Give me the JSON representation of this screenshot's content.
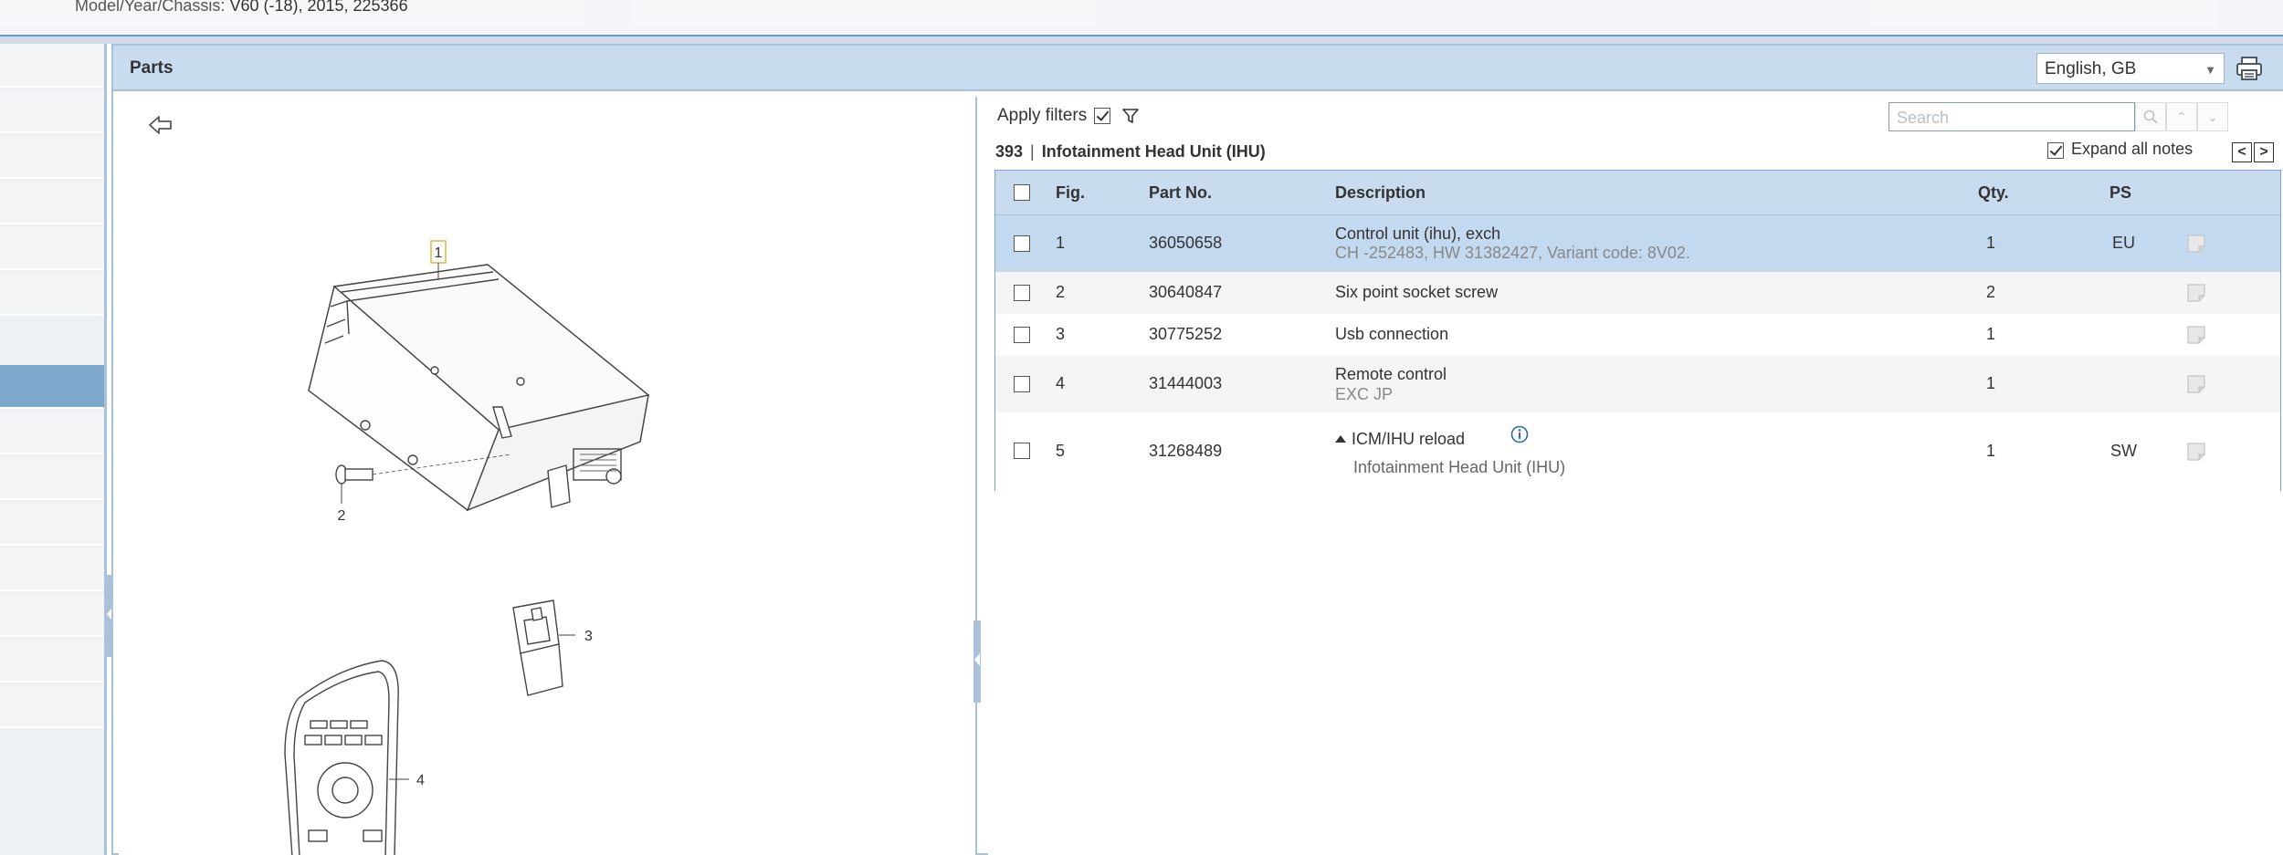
{
  "vehicle": {
    "label": "Model/Year/Chassis:",
    "value": "V60 (-18), 2015, 225366"
  },
  "panel": {
    "title": "Parts",
    "language": "English, GB"
  },
  "illustration": {
    "callouts": [
      "1",
      "2",
      "3",
      "4"
    ]
  },
  "list": {
    "apply_filters_label": "Apply filters",
    "apply_filters_checked": true,
    "search_placeholder": "Search",
    "breadcrumb_code": "393",
    "breadcrumb_sep": "|",
    "breadcrumb_title": "Infotainment Head Unit (IHU)",
    "expand_notes_label": "Expand all notes",
    "expand_notes_checked": true,
    "prev_label": "<",
    "next_label": ">"
  },
  "table": {
    "headers": {
      "fig": "Fig.",
      "part_no": "Part No.",
      "description": "Description",
      "qty": "Qty.",
      "ps": "PS"
    },
    "rows": [
      {
        "fig": "1",
        "part_no": "36050658",
        "description": "Control unit (ihu), exch",
        "note": "CH -252483, HW 31382427, Variant code: 8V02.",
        "qty": "1",
        "ps": "EU",
        "selected": true
      },
      {
        "fig": "2",
        "part_no": "30640847",
        "description": "Six point socket screw",
        "note": "",
        "qty": "2",
        "ps": ""
      },
      {
        "fig": "3",
        "part_no": "30775252",
        "description": "Usb connection",
        "note": "",
        "qty": "1",
        "ps": ""
      },
      {
        "fig": "4",
        "part_no": "31444003",
        "description": "Remote control",
        "note": "EXC JP",
        "qty": "1",
        "ps": ""
      },
      {
        "fig": "5",
        "part_no": "31268489",
        "description": "ICM/IHU reload",
        "note": "Infotainment Head Unit (IHU)",
        "qty": "1",
        "ps": "SW"
      }
    ]
  },
  "colors": {
    "header_bg": "#c9dcef",
    "selected_row": "#c3d9ef",
    "border": "#a9c2da",
    "rail_active": "#7ea7cc",
    "info_icon": "#2b6cb0"
  }
}
